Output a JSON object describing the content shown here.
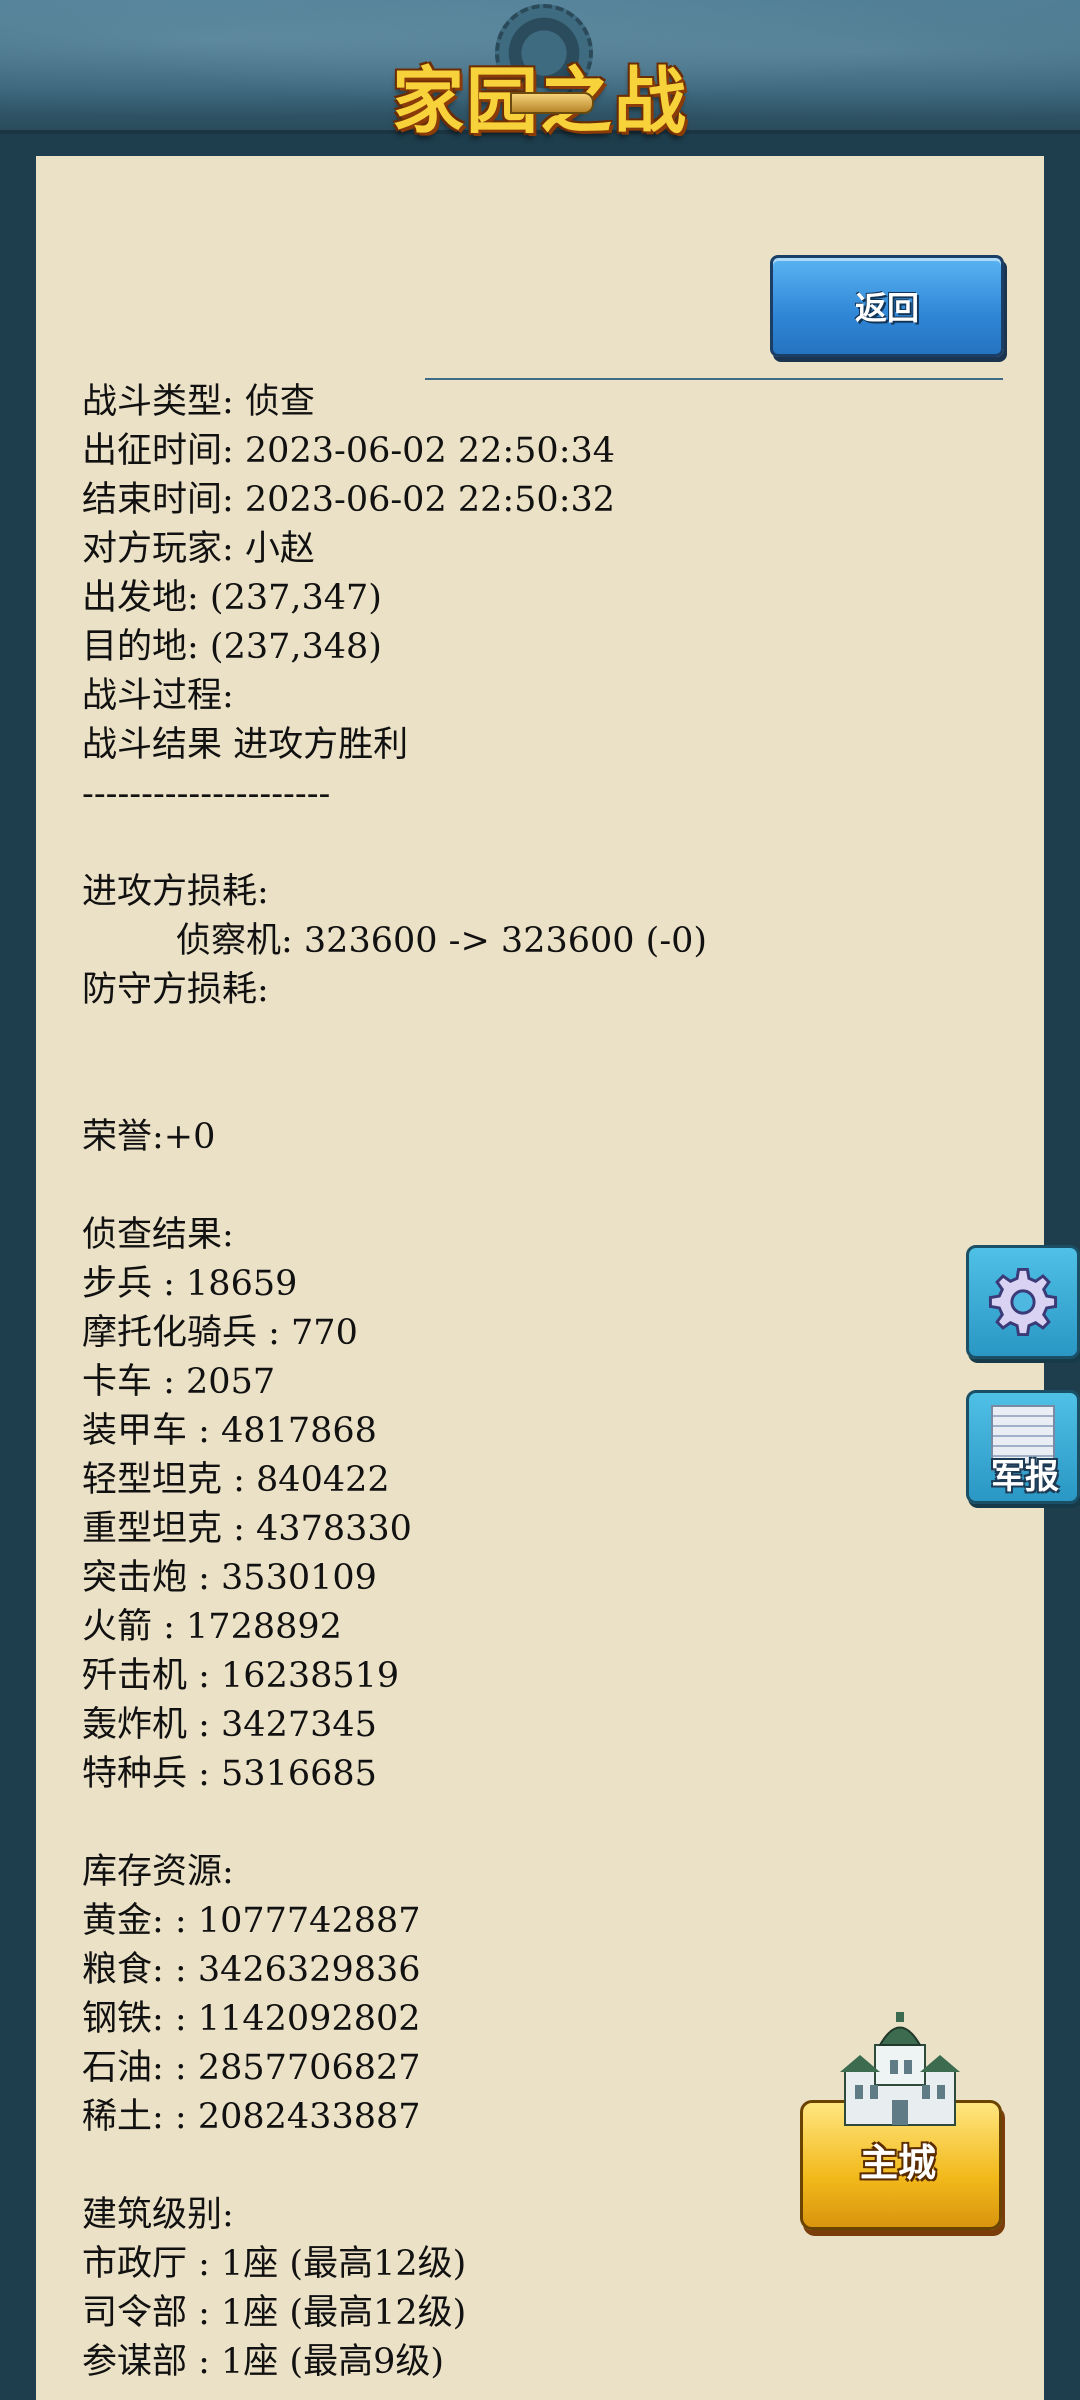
{
  "header": {
    "logo_text": "家园之战"
  },
  "back_button": {
    "label": "返回"
  },
  "report_lines": [
    "战斗类型: 侦查",
    "出征时间: 2023-06-02 22:50:34",
    "结束时间: 2023-06-02 22:50:32",
    "对方玩家: 小赵",
    "出发地: (237,347)",
    "目的地: (237,348)",
    "战斗过程:",
    "战斗结果 进攻方胜利",
    "---------------------",
    "",
    "进攻方损耗:",
    "侦察机: 323600 -> 323600 (-0)",
    "防守方损耗:",
    "",
    "",
    "荣誉:+0",
    "",
    "侦查结果:",
    "步兵 : 18659",
    "摩托化骑兵 : 770",
    "卡车 : 2057",
    "装甲车 : 4817868",
    "轻型坦克 : 840422",
    "重型坦克 : 4378330",
    "突击炮 : 3530109",
    "火箭 : 1728892",
    "歼击机 : 16238519",
    "轰炸机 : 3427345",
    "特种兵 : 5316685",
    "",
    "库存资源:",
    "黄金: : 1077742887",
    "粮食: : 3426329836",
    "钢铁: : 1142092802",
    "石油: : 2857706827",
    "稀土: : 2082433887",
    "",
    "建筑级别:",
    "市政厅 : 1座 (最高12级)",
    "司令部 : 1座 (最高12级)",
    "参谋部 : 1座 (最高9级)"
  ],
  "side_buttons": {
    "settings_icon": "gear-icon",
    "report_label": "军报"
  },
  "main_city": {
    "label": "主城"
  }
}
